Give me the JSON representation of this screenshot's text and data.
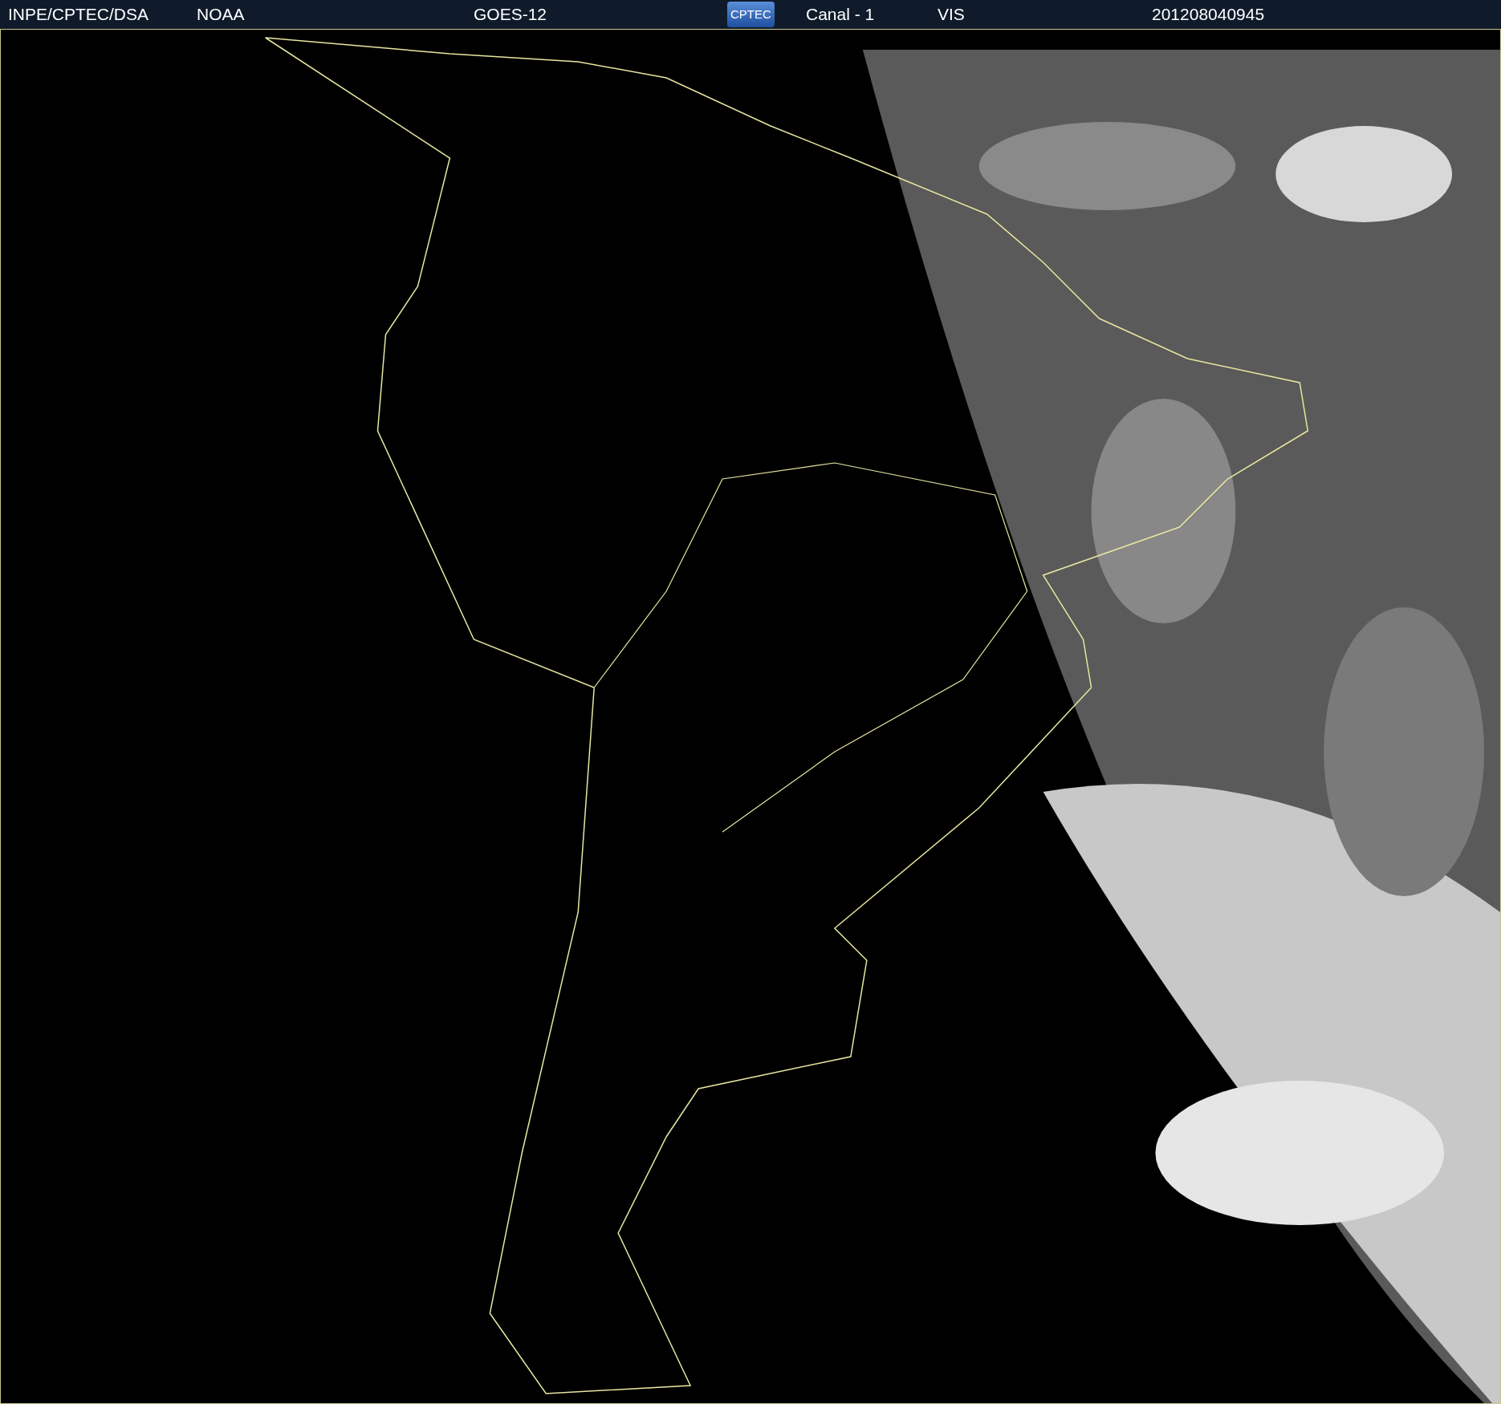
{
  "header": {
    "source": "INPE/CPTEC/DSA",
    "agency": "NOAA",
    "satellite": "GOES-12",
    "logo": "CPTEC",
    "channel": "Canal - 1",
    "band": "VIS",
    "timestamp": "201208040945"
  }
}
